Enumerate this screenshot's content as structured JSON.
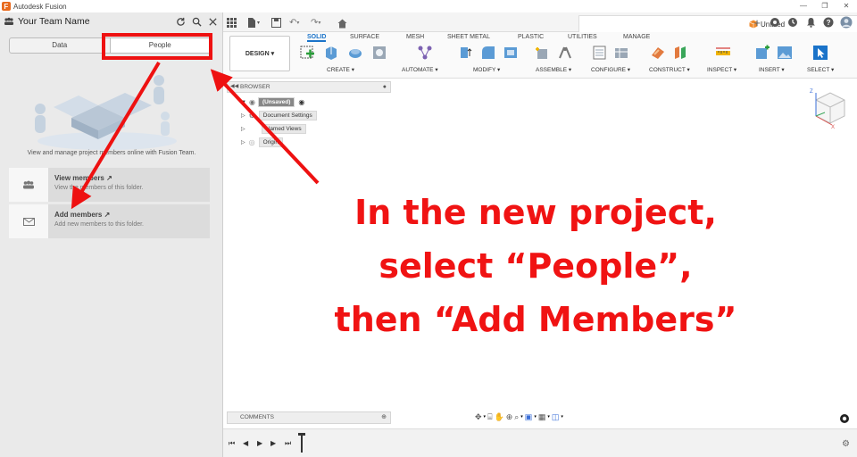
{
  "window": {
    "title": "Autodesk Fusion",
    "controls": [
      "minimize",
      "restore",
      "close"
    ]
  },
  "left_panel": {
    "team_name": "Your Team Name",
    "tabs": [
      {
        "label": "Data"
      },
      {
        "label": "People"
      }
    ],
    "active_tab": "People",
    "description": "View and manage project members online with Fusion Team.",
    "cards": [
      {
        "title": "View members",
        "subtitle": "View the members of this folder."
      },
      {
        "title": "Add members",
        "subtitle": "Add new members to this folder."
      }
    ]
  },
  "document_tab": {
    "title": "Untitled"
  },
  "ribbon": {
    "workspace": "DESIGN ▾",
    "tabs": [
      "SOLID",
      "SURFACE",
      "MESH",
      "SHEET METAL",
      "PLASTIC",
      "UTILITIES",
      "MANAGE"
    ],
    "active_tab": "SOLID",
    "groups": [
      "CREATE ▾",
      "AUTOMATE ▾",
      "MODIFY ▾",
      "ASSEMBLE ▾",
      "CONFIGURE ▾",
      "CONSTRUCT ▾",
      "INSPECT ▾",
      "INSERT ▾",
      "SELECT ▾"
    ]
  },
  "browser": {
    "header": "BROWSER",
    "root": "(Unsaved)",
    "items": [
      "Document Settings",
      "Named Views",
      "Origin"
    ]
  },
  "comments": {
    "label": "COMMENTS"
  },
  "viewcube": {
    "z_label": "Z",
    "x_label": "X"
  },
  "annotation": {
    "lines": [
      "In the new project,",
      "select “People”,",
      "then “Add Members”"
    ],
    "color": "#f01313"
  },
  "colors": {
    "accent": "#1a73c9",
    "highlight": "#e11111"
  }
}
